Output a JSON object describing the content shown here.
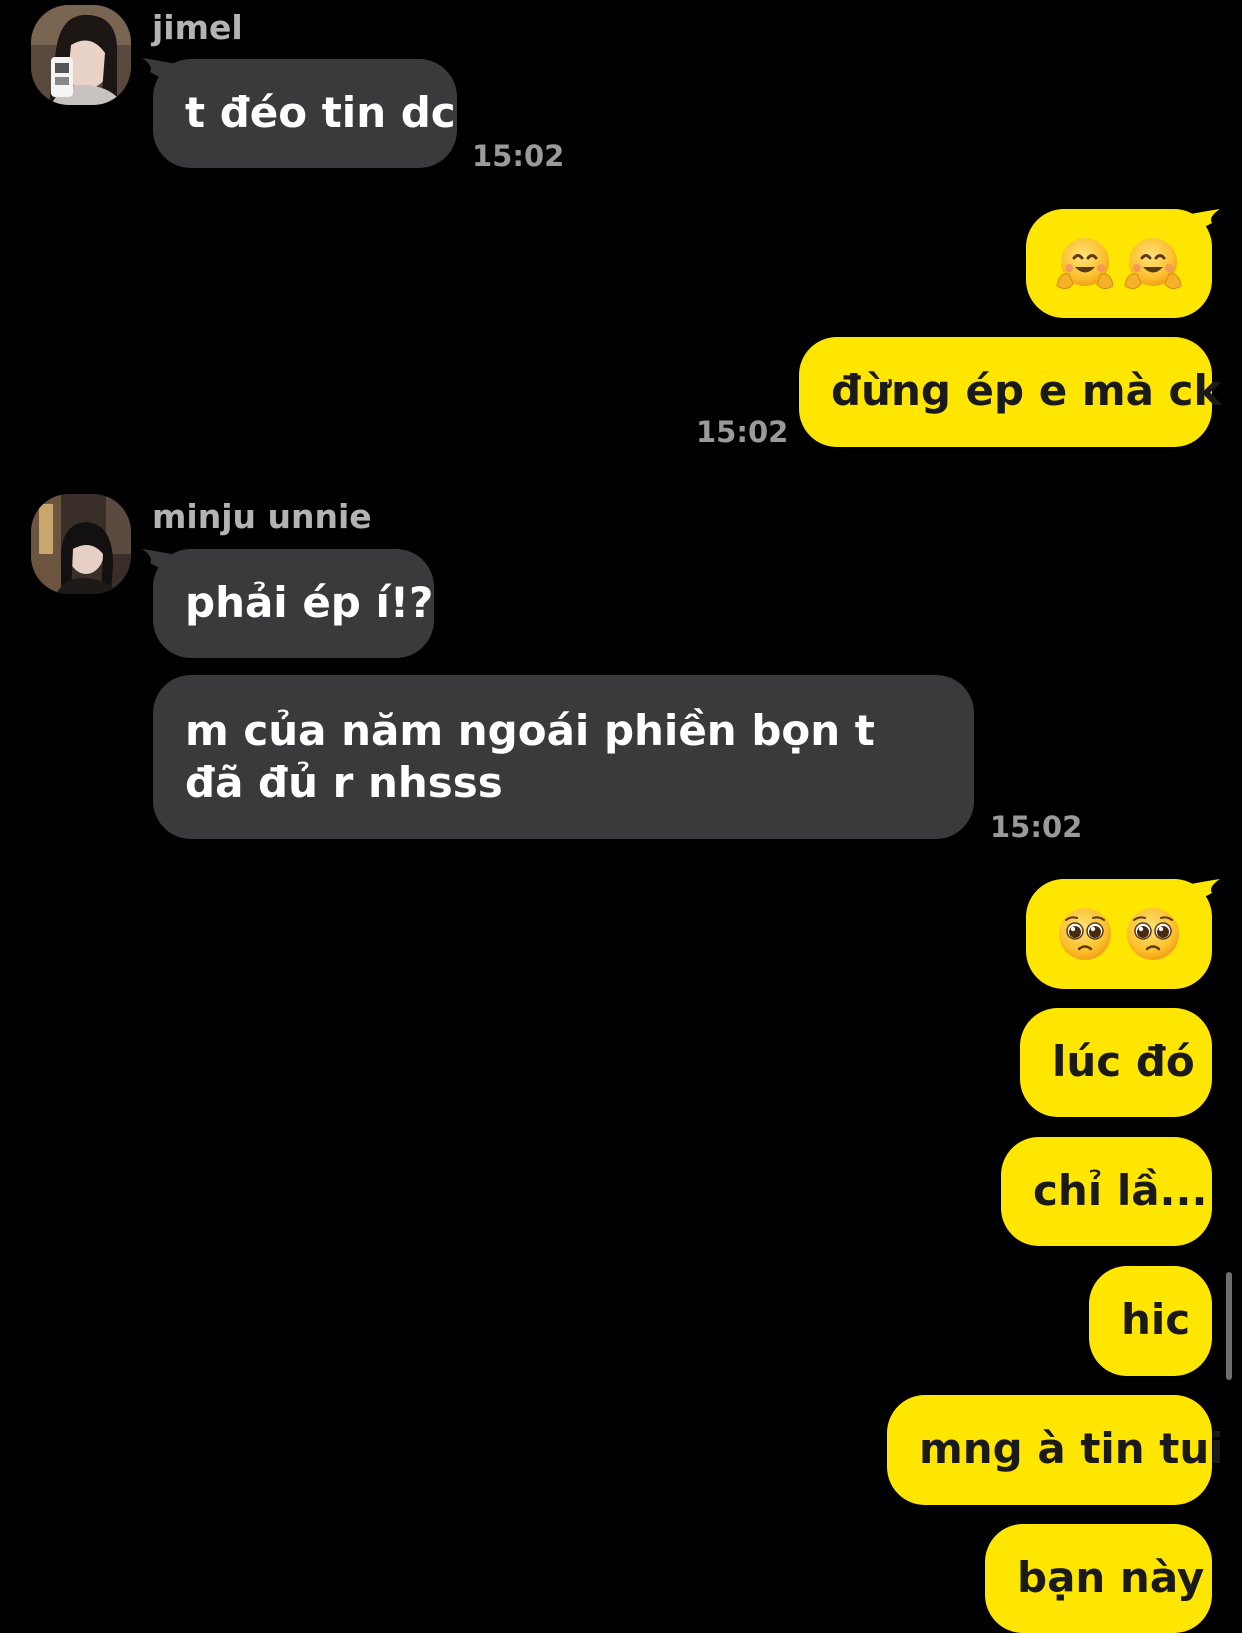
{
  "colors": {
    "background": "#000000",
    "incoming_bubble": "#3a3a3c",
    "outgoing_bubble": "#ffe600",
    "sender_name": "#b3b3b3",
    "timestamp": "#9a9a9a"
  },
  "messages": {
    "m1": {
      "sender": "jimel",
      "text": "t đéo tin dc",
      "time": "15:02"
    },
    "m2": {
      "emoji": "smiling-face-with-open-hands (hug) x2"
    },
    "m3": {
      "text": "đừng ép e mà ck",
      "time": "15:02"
    },
    "m4": {
      "sender": "minju unnie",
      "text": "phải ép í!?"
    },
    "m5": {
      "text": "m của năm ngoái phiền bọn t đã đủ r nhsss",
      "time": "15:02"
    },
    "m6": {
      "emoji": "pleading-face x2"
    },
    "m7": {
      "text": "lúc đó"
    },
    "m8": {
      "text": "chỉ lầ..."
    },
    "m9": {
      "text": "hic"
    },
    "m10": {
      "text": "mng à tin tui"
    },
    "m11": {
      "text": "bạn này"
    }
  }
}
